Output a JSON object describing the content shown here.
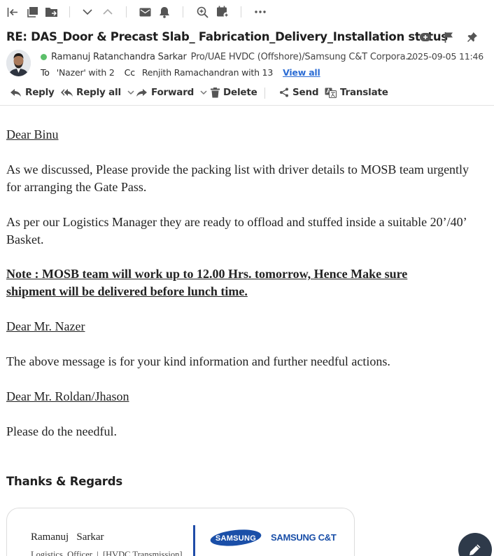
{
  "toolbar": {
    "icons": [
      "collapse-left-icon",
      "copy-icon",
      "move-folder-icon",
      "chevron-down-icon",
      "chevron-up-icon",
      "mail-icon",
      "bell-icon",
      "zoom-in-icon",
      "calendar-add-icon",
      "more-icon"
    ]
  },
  "email": {
    "subject": "RE: DAS_Door & Precast Slab_ Fabrication_Delivery_Installation status",
    "sender_name": "Ramanuj Ratanchandra Sarkar",
    "sender_org": "Pro/UAE HVDC (Offshore)/Samsung C&T Corpora...",
    "date": "2025-09-05 11:46",
    "to_label": "To",
    "to_value": "'Nazer' with 2",
    "cc_label": "Cc",
    "cc_value": "Renjith Ramachandran with 13",
    "view_all": "View all",
    "presence_color": "#5cbf6a"
  },
  "actions": {
    "reply": "Reply",
    "reply_all": "Reply all",
    "forward": "Forward",
    "delete": "Delete",
    "send": "Send",
    "translate": "Translate"
  },
  "body": {
    "greeting1": "Dear Binu",
    "para1": "As we discussed, Please provide the packing list with driver details to MOSB team urgently for arranging the Gate Pass.",
    "para2": "As per our Logistics Manager they are ready to offload and stuffed inside a suitable 20’/40’ Basket.",
    "note": "Note : MOSB team will work up to 12.00 Hrs. tomorrow, Hence Make sure shipment will be delivered before lunch time.",
    "greeting2": "Dear Mr. Nazer",
    "para3": "The above message is for your kind information and further needful actions.",
    "greeting3": "Dear Mr. Roldan/Jhason",
    "para4": "Please do the needful."
  },
  "signature": {
    "regards": "Thanks & Regards",
    "name": "Ramanuj   Sarkar",
    "title": "Logistics  Officer  |  [HVDC Transmission]",
    "logo_text": "SAMSUNG",
    "company": "SAMSUNG C&T",
    "brand_color": "#1a4fa8"
  }
}
